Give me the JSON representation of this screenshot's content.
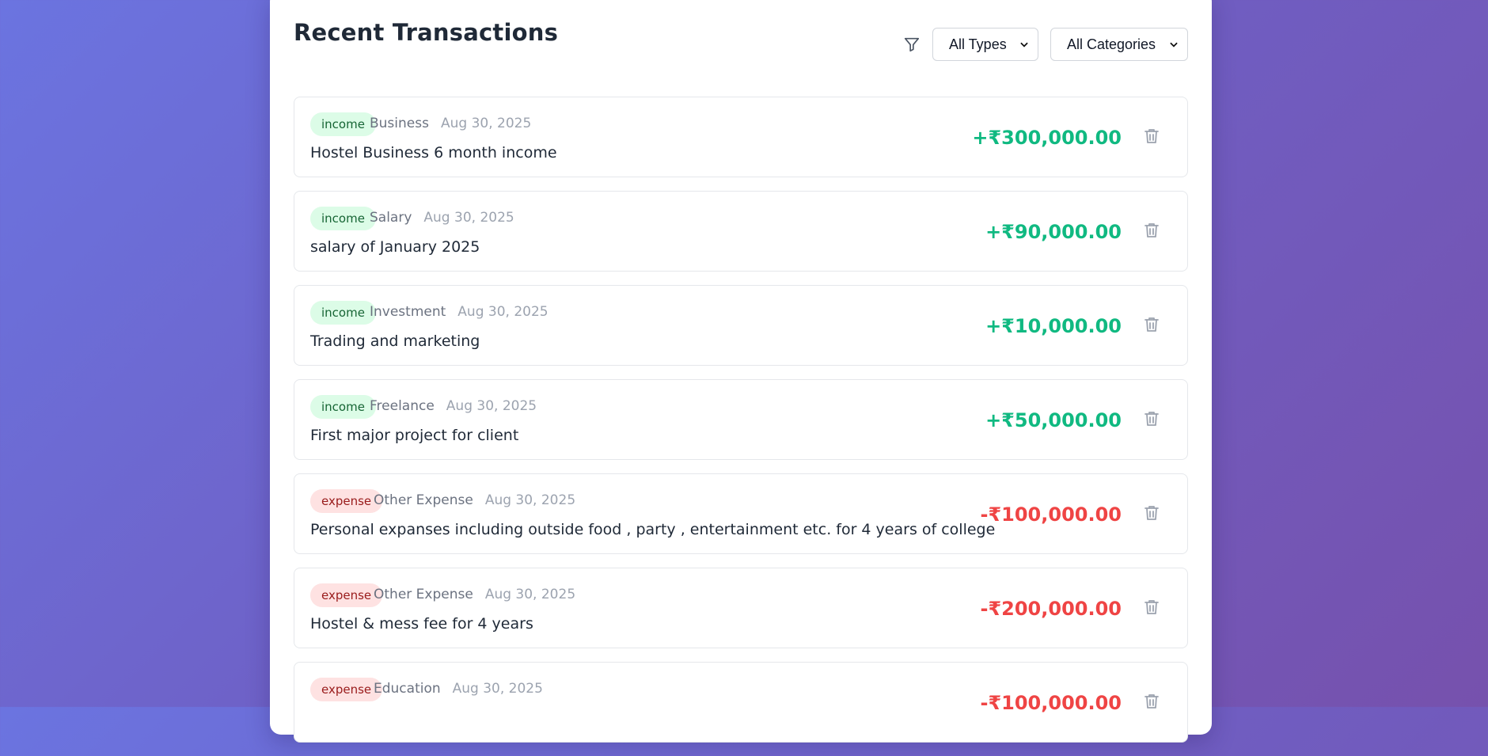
{
  "header": {
    "title": "Recent Transactions",
    "filter_icon": "filter-icon",
    "type_filter": {
      "selected": "All Types"
    },
    "category_filter": {
      "selected": "All Categories"
    }
  },
  "colors": {
    "income_badge_bg": "#dcfce7",
    "income_text": "#10b981",
    "expense_badge_bg": "#fee2e2",
    "expense_text": "#ef4444"
  },
  "transactions": [
    {
      "type": "income",
      "category": "Business",
      "date": "Aug 30, 2025",
      "description": "Hostel Business 6 month income",
      "amount": "+₹300,000.00"
    },
    {
      "type": "income",
      "category": "Salary",
      "date": "Aug 30, 2025",
      "description": "salary of January 2025",
      "amount": "+₹90,000.00"
    },
    {
      "type": "income",
      "category": "Investment",
      "date": "Aug 30, 2025",
      "description": "Trading and marketing",
      "amount": "+₹10,000.00"
    },
    {
      "type": "income",
      "category": "Freelance",
      "date": "Aug 30, 2025",
      "description": "First major project for client",
      "amount": "+₹50,000.00"
    },
    {
      "type": "expense",
      "category": "Other Expense",
      "date": "Aug 30, 2025",
      "description": "Personal expanses including outside food , party , entertainment etc. for 4 years of college",
      "amount": "-₹100,000.00"
    },
    {
      "type": "expense",
      "category": "Other Expense",
      "date": "Aug 30, 2025",
      "description": "Hostel & mess fee for 4 years",
      "amount": "-₹200,000.00"
    },
    {
      "type": "expense",
      "category": "Education",
      "date": "Aug 30, 2025",
      "description": "",
      "amount": "-₹100,000.00"
    }
  ]
}
